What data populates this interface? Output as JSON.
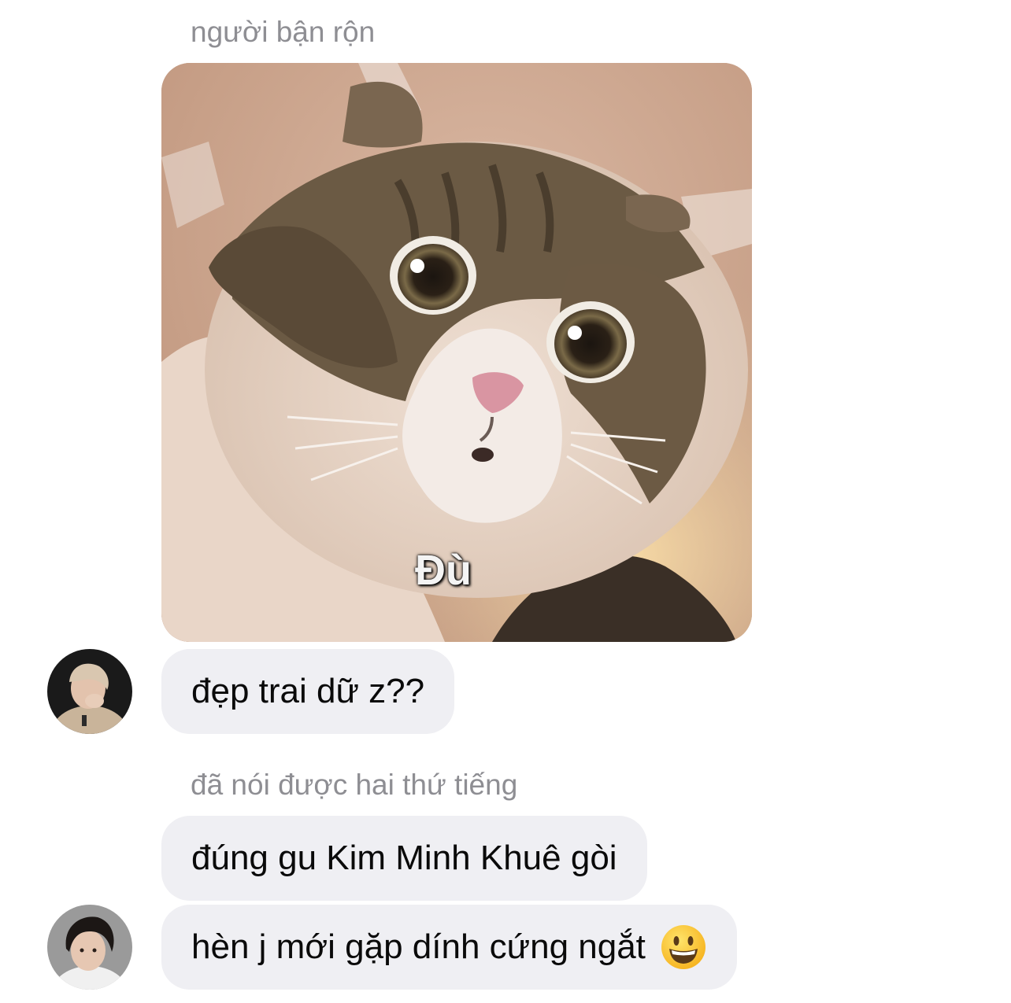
{
  "messages": [
    {
      "type": "sender-label",
      "text": "người bận rộn"
    },
    {
      "type": "sticker",
      "caption": "Đù",
      "image_icon": "surprised-cat-sticker"
    },
    {
      "type": "text",
      "text": "đẹp trai dữ z??",
      "has_avatar": true
    },
    {
      "type": "sender-label",
      "text": "đã nói được hai thứ tiếng"
    },
    {
      "type": "text",
      "text": "đúng gu Kim Minh Khuê gòi"
    },
    {
      "type": "text",
      "text": "hèn j mới gặp dính cứng ngắt",
      "emoji": "grinning-face-emoji",
      "has_avatar": true
    }
  ],
  "colors": {
    "bubble_bg": "#efeff3",
    "sender_label": "#8e8e93",
    "message_text": "#0a0a0a"
  }
}
